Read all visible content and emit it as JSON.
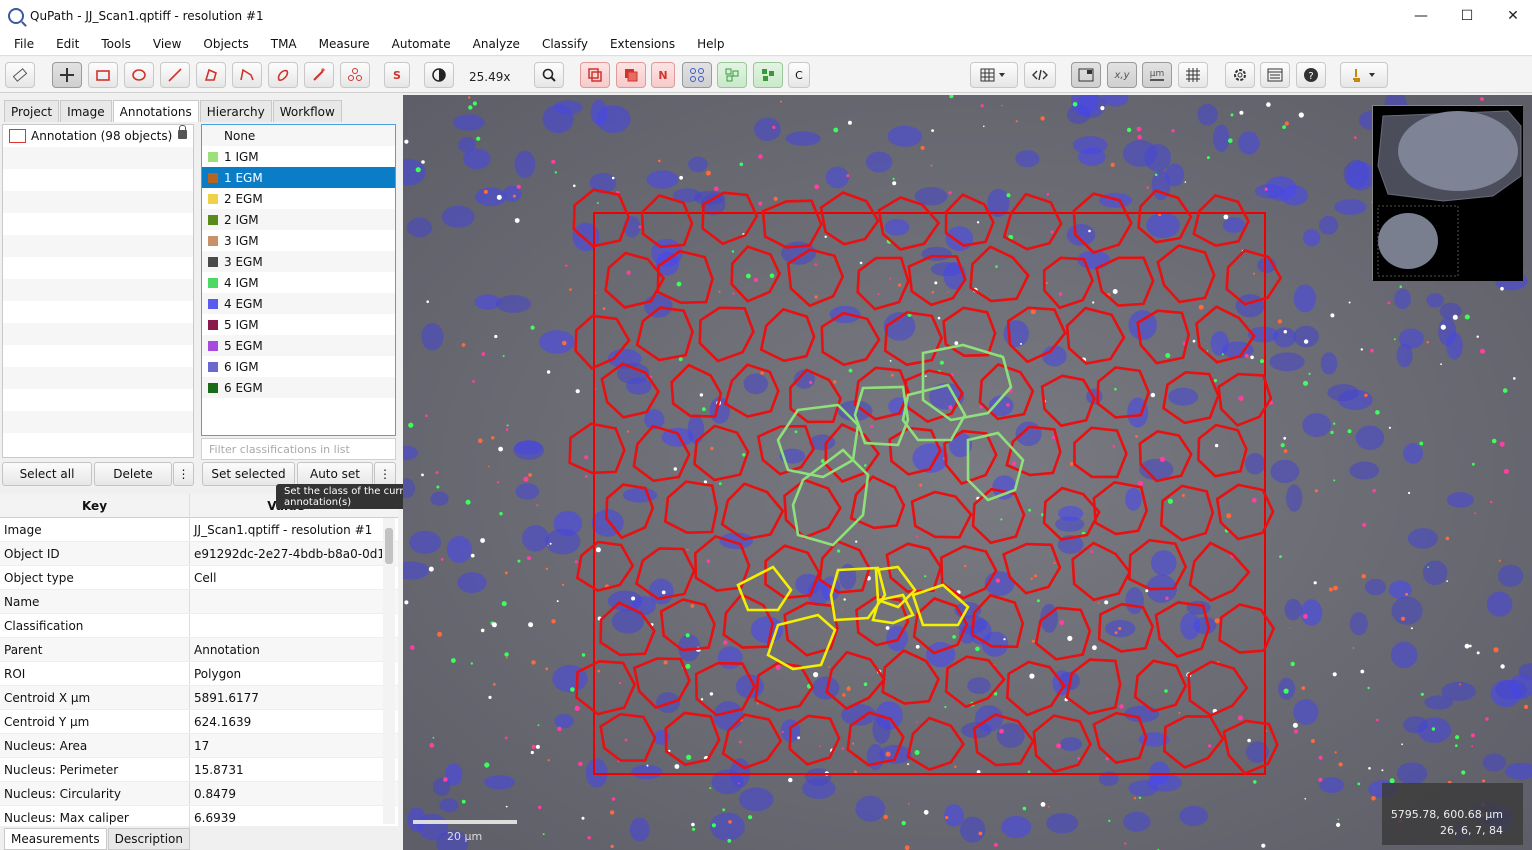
{
  "window": {
    "title": "QuPath - JJ_Scan1.qptiff - resolution #1"
  },
  "menu": [
    "File",
    "Edit",
    "Tools",
    "View",
    "Objects",
    "TMA",
    "Measure",
    "Automate",
    "Analyze",
    "Classify",
    "Extensions",
    "Help"
  ],
  "toolbar": {
    "zoom": "25.49x",
    "s_label": "S",
    "n_label": "N",
    "c_label": "C",
    "xy_label": "x,y",
    "um_label": "µm"
  },
  "tabs": [
    "Project",
    "Image",
    "Annotations",
    "Hierarchy",
    "Workflow"
  ],
  "annotations": {
    "item": "Annotation (98 objects)"
  },
  "classes": [
    {
      "name": "None",
      "color": ""
    },
    {
      "name": "1 IGM",
      "color": "#9be07a"
    },
    {
      "name": "1 EGM",
      "color": "#b5651d"
    },
    {
      "name": "2 EGM",
      "color": "#f0d24a"
    },
    {
      "name": "2 IGM",
      "color": "#5a8a1a"
    },
    {
      "name": "3 IGM",
      "color": "#c8916a"
    },
    {
      "name": "3 EGM",
      "color": "#4a4a4a"
    },
    {
      "name": "4 IGM",
      "color": "#4cd964"
    },
    {
      "name": "4 EGM",
      "color": "#5a5af0"
    },
    {
      "name": "5 IGM",
      "color": "#8a1a4a"
    },
    {
      "name": "5 EGM",
      "color": "#a64ae0"
    },
    {
      "name": "6 IGM",
      "color": "#6a6acc"
    },
    {
      "name": "6 EGM",
      "color": "#1a6a1a"
    }
  ],
  "class_filter": {
    "placeholder": "Filter classifications in list"
  },
  "buttons": {
    "select_all": "Select all",
    "delete": "Delete",
    "set_selected": "Set selected",
    "auto_set": "Auto set",
    "more": "⋮"
  },
  "tooltip": "Set the class of the currently-selected annotation(s)",
  "properties": {
    "key_header": "Key",
    "value_header": "Value",
    "rows": [
      {
        "k": "Image",
        "v": "JJ_Scan1.qptiff - resolution #1"
      },
      {
        "k": "Object ID",
        "v": "e91292dc-2e27-4bdb-b8a0-0d1..."
      },
      {
        "k": "Object type",
        "v": "Cell"
      },
      {
        "k": "Name",
        "v": ""
      },
      {
        "k": "Classification",
        "v": ""
      },
      {
        "k": "Parent",
        "v": "Annotation"
      },
      {
        "k": "ROI",
        "v": "Polygon"
      },
      {
        "k": "Centroid X µm",
        "v": "5891.6177"
      },
      {
        "k": "Centroid Y µm",
        "v": "624.1639"
      },
      {
        "k": "Nucleus: Area",
        "v": "17"
      },
      {
        "k": "Nucleus: Perimeter",
        "v": "15.8731"
      },
      {
        "k": "Nucleus: Circularity",
        "v": "0.8479"
      },
      {
        "k": "Nucleus: Max caliper",
        "v": "6.6939"
      }
    ]
  },
  "bottom_tabs": [
    "Measurements",
    "Description"
  ],
  "viewer": {
    "scale": "20 µm",
    "coord1": "5795.78, 600.68 µm",
    "coord2": "26, 6, 7, 84"
  },
  "window_controls": {
    "minimize": "—",
    "maximize": "☐",
    "close": "✕"
  }
}
